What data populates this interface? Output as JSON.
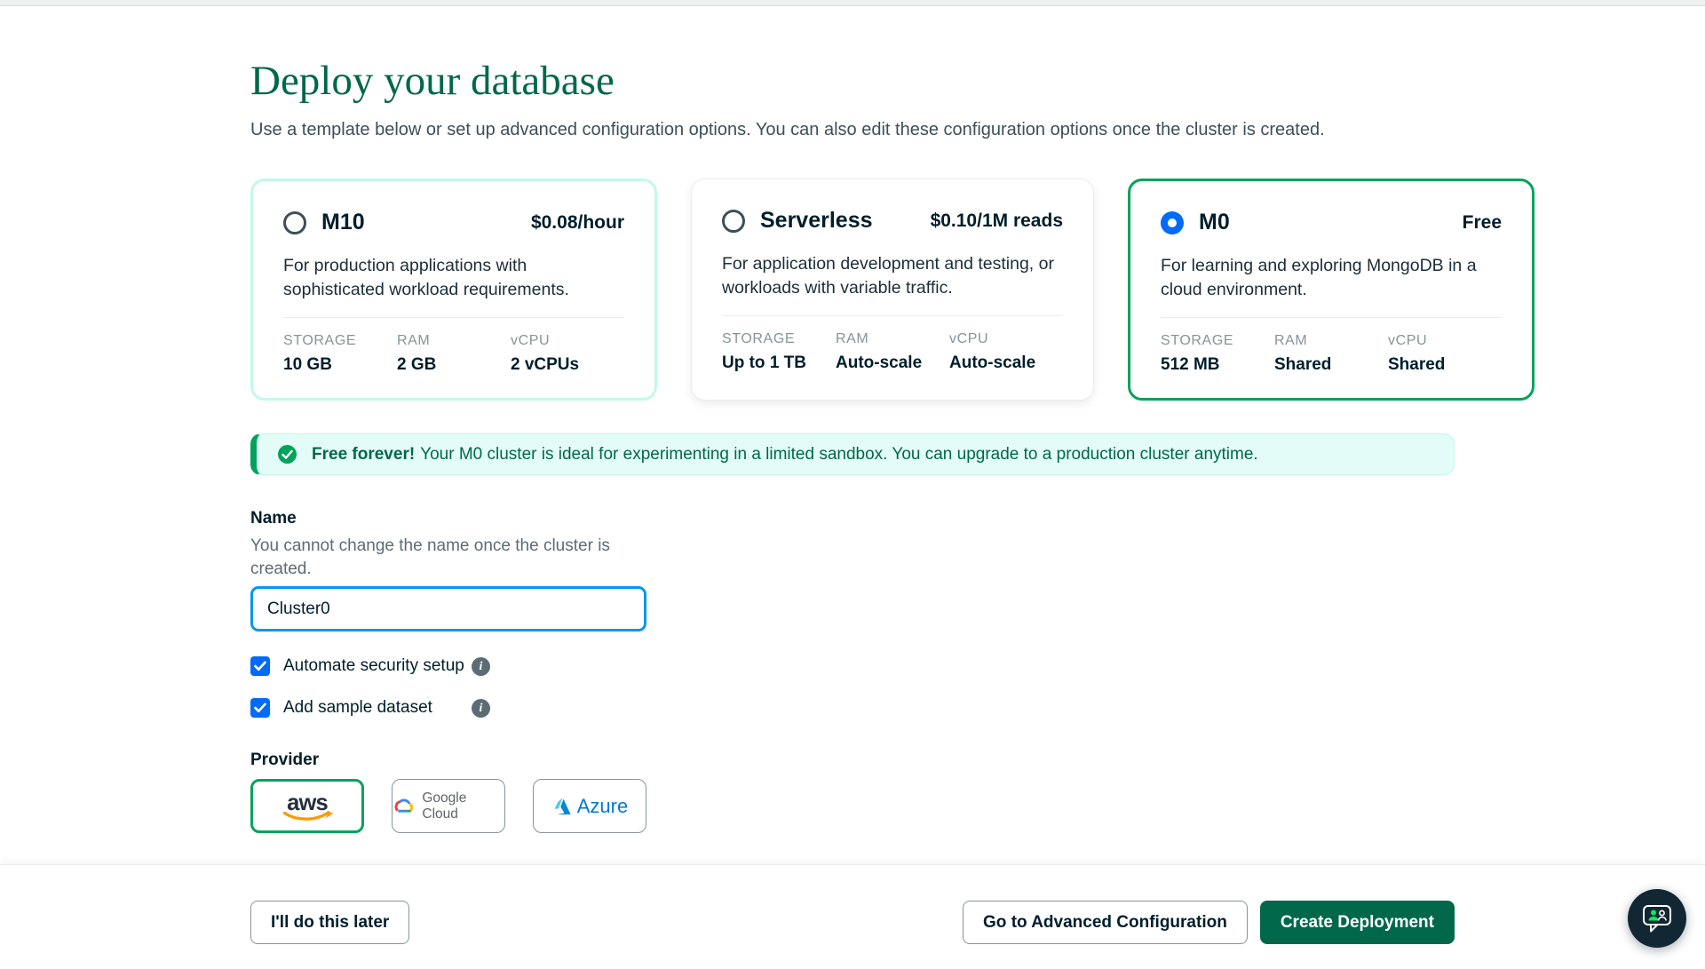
{
  "page": {
    "title": "Deploy your database",
    "subtitle": "Use a template below or set up advanced configuration options. You can also edit these configuration options once the cluster is created."
  },
  "spec_headers": [
    "STORAGE",
    "RAM",
    "vCPU"
  ],
  "tiers": [
    {
      "name": "M10",
      "price": "$0.08/hour",
      "description": "For production applications with sophisticated workload requirements.",
      "storage": "10 GB",
      "ram": "2 GB",
      "vcpu": "2 vCPUs",
      "selected": false
    },
    {
      "name": "Serverless",
      "price": "$0.10/1M reads",
      "description": "For application development and testing, or workloads with variable traffic.",
      "storage": "Up to 1 TB",
      "ram": "Auto-scale",
      "vcpu": "Auto-scale",
      "selected": false
    },
    {
      "name": "M0",
      "price": "Free",
      "description": "For learning and exploring MongoDB in a cloud environment.",
      "storage": "512 MB",
      "ram": "Shared",
      "vcpu": "Shared",
      "selected": true
    }
  ],
  "banner": {
    "bold_text": "Free forever!",
    "text": "Your M0 cluster is ideal for experimenting in a limited sandbox. You can upgrade to a production cluster anytime.",
    "icon": "check-circle-icon"
  },
  "name_field": {
    "label": "Name",
    "helper": "You cannot change the name once the cluster is created.",
    "value": "Cluster0"
  },
  "options": [
    {
      "label": "Automate security setup",
      "checked": true
    },
    {
      "label": "Add sample dataset",
      "checked": true
    }
  ],
  "provider": {
    "label": "Provider",
    "options": [
      {
        "name": "AWS",
        "logo_text": "aws",
        "selected": true
      },
      {
        "name": "Google Cloud",
        "logo_text": "Google Cloud",
        "selected": false
      },
      {
        "name": "Azure",
        "logo_text": "Azure",
        "selected": false
      }
    ]
  },
  "footer": {
    "later_label": "I'll do this later",
    "advanced_label": "Go to Advanced Configuration",
    "create_label": "Create Deployment"
  },
  "colors": {
    "title_green": "#00684A",
    "selected_border_green": "#00A35C",
    "m10_border_mint": "#C0FAE6",
    "banner_bg": "#E3FCF7",
    "radio_checkbox_blue": "#016BF8",
    "input_focus_blue": "#0498EC",
    "primary_button_green": "#00684A",
    "dark_text": "#001E2B",
    "muted_text": "#5C6C75",
    "spec_label_gray": "#889397",
    "chat_bubble_navy": "#112733",
    "aws_orange": "#FF9900",
    "azure_blue": "#0078D4"
  }
}
